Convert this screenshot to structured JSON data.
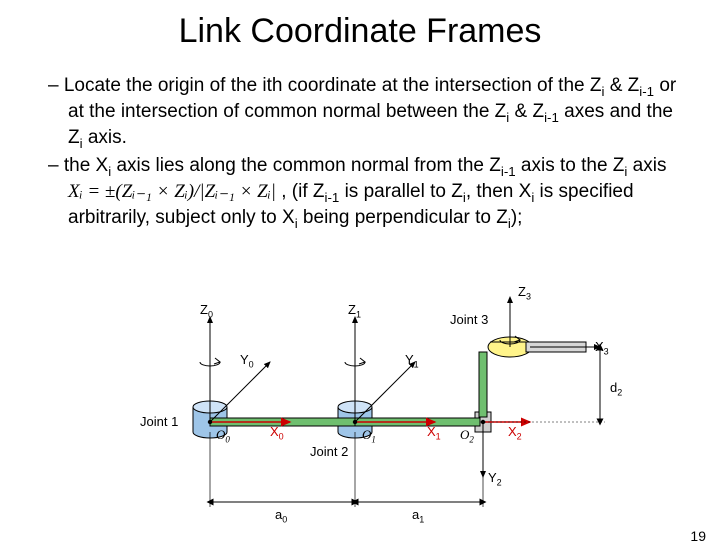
{
  "title": "Link Coordinate Frames",
  "bullets": {
    "b1_prefix": "–  Locate the origin of the ith coordinate at the intersection of the Z",
    "b1_mid1": " & Z",
    "b1_mid2": "  or at the intersection of common normal between the Z",
    "b1_mid3": " & Z",
    "b1_mid4": " axes and the Z",
    "b1_suffix": " axis.",
    "b2_prefix": "–  the X",
    "b2_mid1": " axis lies along the common normal from the Z",
    "b2_mid2": " axis to the Z",
    "b2_mid3": " axis  ",
    "formula": "Xᵢ = ±(Zᵢ₋₁ × Zᵢ)/|Zᵢ₋₁ × Zᵢ|",
    "b2_mid4": " , (if Z",
    "b2_mid5": " is parallel to Z",
    "b2_mid6": ", then X",
    "b2_mid7": " is specified arbitrarily, subject only to X",
    "b2_mid8": " being perpendicular to Z",
    "b2_suffix": ");"
  },
  "diagram_labels": {
    "z0": "Z",
    "z0s": "0",
    "z1": "Z",
    "z1s": "1",
    "z3": "Z",
    "z3s": "3",
    "y0": "Y",
    "y0s": "0",
    "y1": "Y",
    "y1s": "1",
    "y2": "Y",
    "y2s": "2",
    "x0": "X",
    "x0s": "0",
    "x1": "X",
    "x1s": "1",
    "x2": "X",
    "x2s": "2",
    "x3": "X",
    "x3s": "3",
    "d2": "d",
    "d2s": "2",
    "a0": "a",
    "a0s": "0",
    "a1": "a",
    "a1s": "1",
    "o0": "O",
    "o0s": "0",
    "o1": "O",
    "o1s": "1",
    "o2": "O",
    "o2s": "2",
    "j1": "Joint 1",
    "j2": "Joint 2",
    "j3": "Joint 3"
  },
  "page_number": "19"
}
